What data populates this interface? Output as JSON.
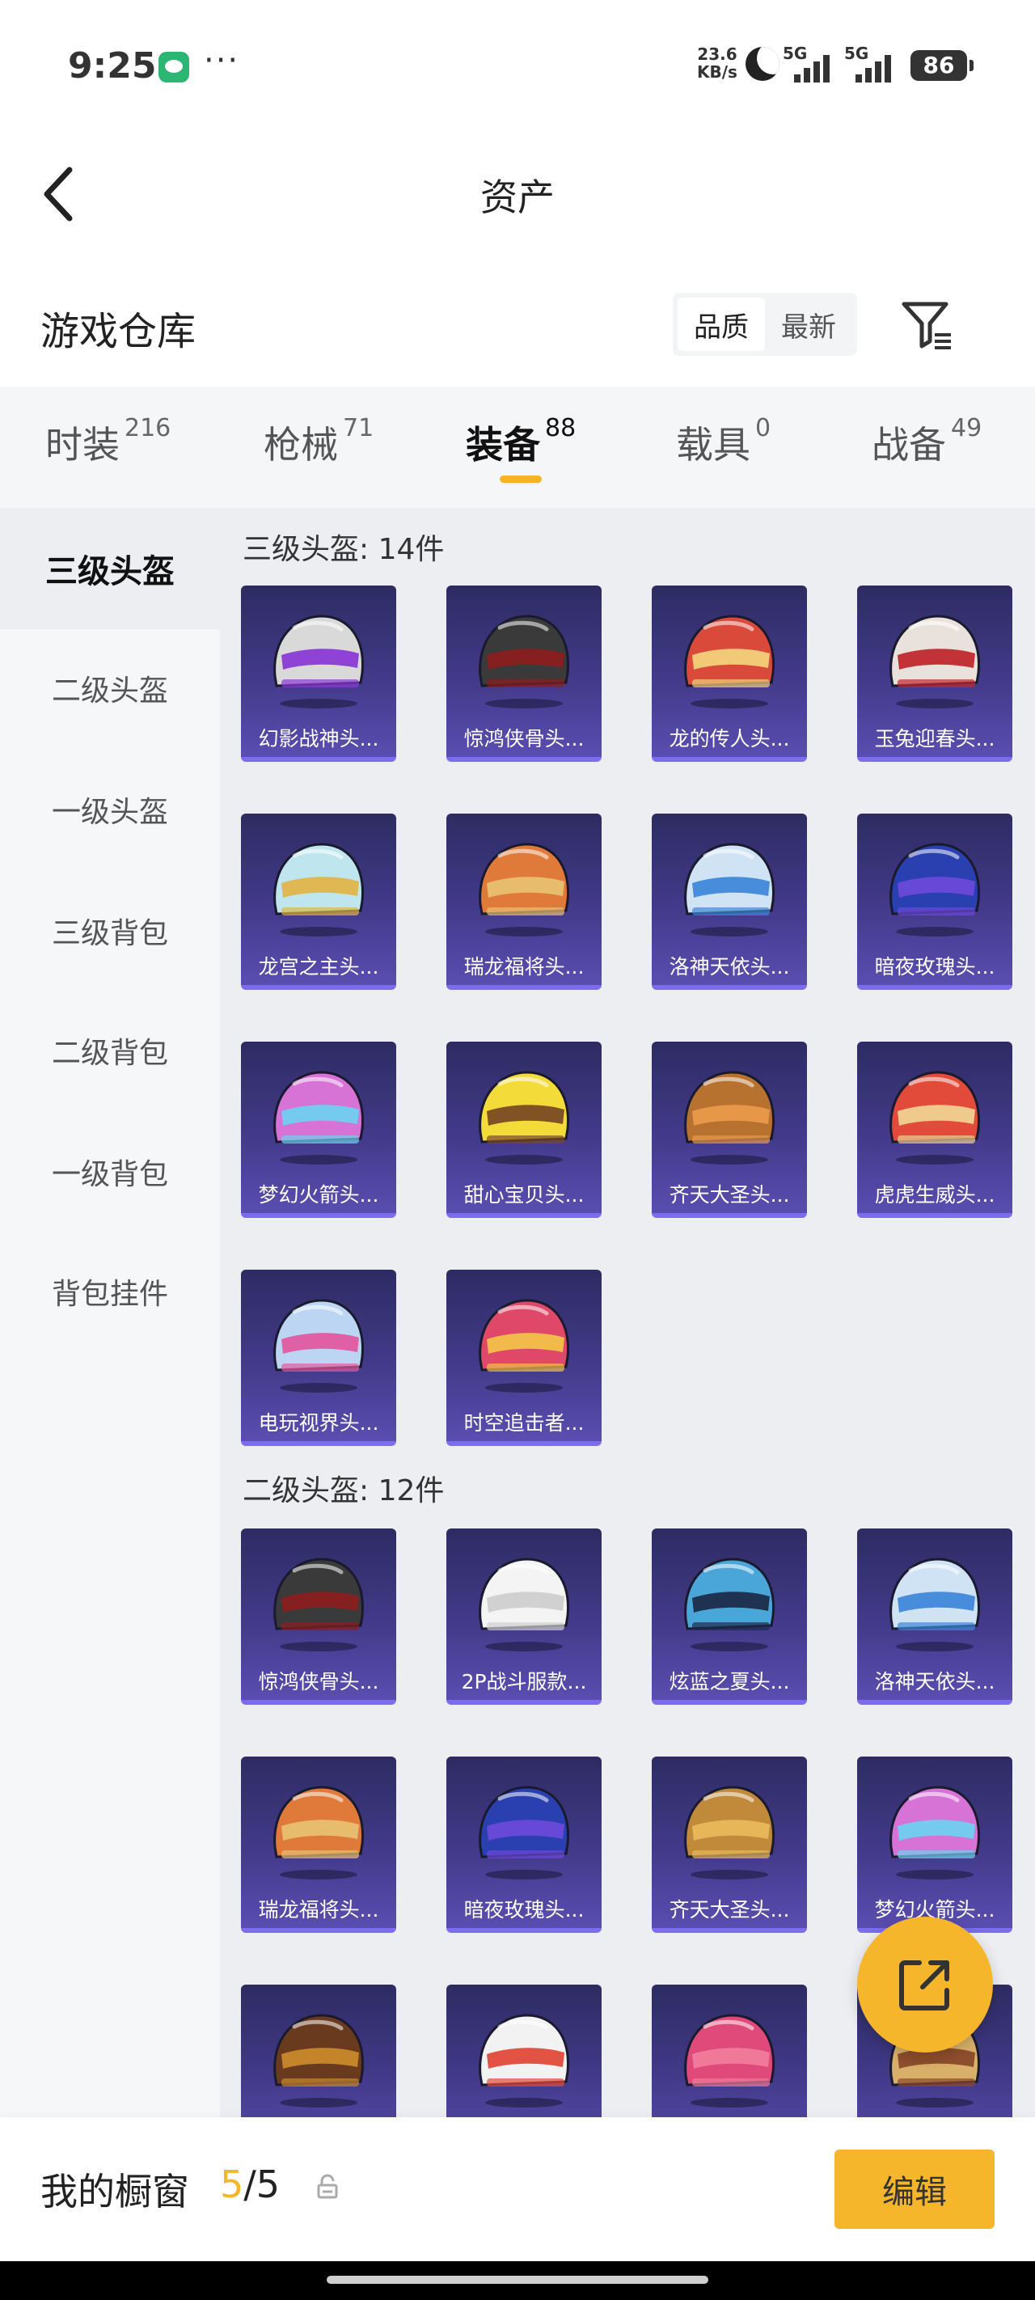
{
  "status_bar": {
    "time": "9:25",
    "more": "···",
    "net_speed_value": "23.6",
    "net_speed_unit": "KB/s",
    "sim1": "5G",
    "sim2": "5G",
    "battery": "86"
  },
  "header": {
    "title": "资产"
  },
  "warehouse": {
    "title": "游戏仓库",
    "sort_options": [
      "品质",
      "最新"
    ],
    "active_sort": "品质"
  },
  "tabs": [
    {
      "label": "时装",
      "count": "216"
    },
    {
      "label": "枪械",
      "count": "71"
    },
    {
      "label": "装备",
      "count": "88"
    },
    {
      "label": "载具",
      "count": "0"
    },
    {
      "label": "战备",
      "count": "49"
    }
  ],
  "active_tab": "装备",
  "sidebar": [
    {
      "label": "三级头盔"
    },
    {
      "label": "二级头盔"
    },
    {
      "label": "一级头盔"
    },
    {
      "label": "三级背包"
    },
    {
      "label": "二级背包"
    },
    {
      "label": "一级背包"
    },
    {
      "label": "背包挂件"
    }
  ],
  "sections": [
    {
      "header": "三级头盔: 14件",
      "items": [
        {
          "name": "幻影战神头...",
          "colors": [
            "#d9d9d9",
            "#8a3bd6"
          ]
        },
        {
          "name": "惊鸿侠骨头...",
          "colors": [
            "#3a3a3a",
            "#8a1e1e"
          ]
        },
        {
          "name": "龙的传人头...",
          "colors": [
            "#d94a3a",
            "#f2d07a"
          ]
        },
        {
          "name": "玉兔迎春头...",
          "colors": [
            "#e9e2dc",
            "#c0282d"
          ]
        },
        {
          "name": "龙宫之主头...",
          "colors": [
            "#bfe6ee",
            "#e0b54a"
          ]
        },
        {
          "name": "瑞龙福将头...",
          "colors": [
            "#e07a3a",
            "#e8c070"
          ]
        },
        {
          "name": "洛神天依头...",
          "colors": [
            "#cfe3f5",
            "#3f88d9"
          ]
        },
        {
          "name": "暗夜玫瑰头...",
          "colors": [
            "#2a3fb0",
            "#6b49d8"
          ]
        },
        {
          "name": "梦幻火箭头...",
          "colors": [
            "#d772d6",
            "#6fd0f0"
          ]
        },
        {
          "name": "甜心宝贝头...",
          "colors": [
            "#f3dc3a",
            "#7a4a22"
          ]
        },
        {
          "name": "齐天大圣头...",
          "colors": [
            "#b8722f",
            "#e89a4a"
          ]
        },
        {
          "name": "虎虎生威头...",
          "colors": [
            "#e24a3a",
            "#f0d090"
          ]
        },
        {
          "name": "电玩视界头...",
          "colors": [
            "#bcd5f2",
            "#e25aa0"
          ]
        },
        {
          "name": "时空追击者...",
          "colors": [
            "#e0486a",
            "#f2c14a"
          ]
        }
      ]
    },
    {
      "header": "二级头盔: 12件",
      "items": [
        {
          "name": "惊鸿侠骨头...",
          "colors": [
            "#3a3a3a",
            "#8a1e1e"
          ]
        },
        {
          "name": "2P战斗服款...",
          "colors": [
            "#f4f4f4",
            "#cfcfcf"
          ]
        },
        {
          "name": "炫蓝之夏头...",
          "colors": [
            "#4aa6d9",
            "#1d2b4a"
          ]
        },
        {
          "name": "洛神天依头...",
          "colors": [
            "#cfe3f5",
            "#3f88d9"
          ]
        },
        {
          "name": "瑞龙福将头...",
          "colors": [
            "#e07a3a",
            "#e8c070"
          ]
        },
        {
          "name": "暗夜玫瑰头...",
          "colors": [
            "#2a3fb0",
            "#6b49d8"
          ]
        },
        {
          "name": "齐天大圣头...",
          "colors": [
            "#c08a3a",
            "#e8b85a"
          ]
        },
        {
          "name": "梦幻火箭头...",
          "colors": [
            "#d772d6",
            "#6fd0f0"
          ]
        },
        {
          "name": "",
          "colors": [
            "#6a3a1e",
            "#c9882a"
          ]
        },
        {
          "name": "",
          "colors": [
            "#f2f2f2",
            "#e24a3a"
          ]
        },
        {
          "name": "",
          "colors": [
            "#e04a7a",
            "#f07a9a"
          ]
        },
        {
          "name": "",
          "colors": [
            "#d9b06a",
            "#8a4a2a"
          ]
        }
      ]
    }
  ],
  "showcase": {
    "label": "我的橱窗",
    "current": "5",
    "total": "/5"
  },
  "edit_label": "编辑"
}
